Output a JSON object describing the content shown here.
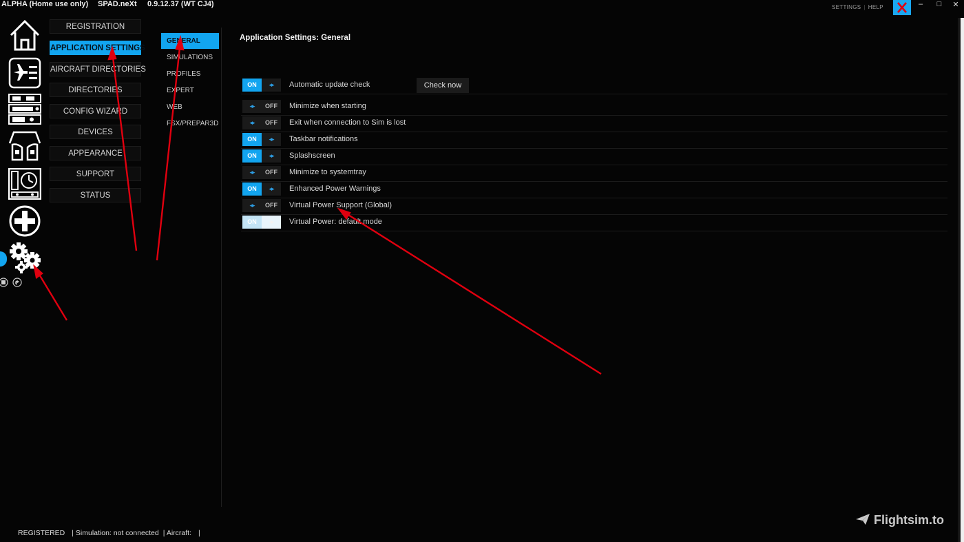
{
  "titlebar": {
    "license": "ALPHA (Home use only)",
    "app_name": "SPAD.neXt",
    "version": "0.9.12.37 (WT CJ4)",
    "settings_link": "SETTINGS",
    "help_link": "HELP",
    "minimize": "–",
    "maximize": "□",
    "close": "✕"
  },
  "nav_icons": [
    "home-icon",
    "aircraft-profile-icon",
    "radio-stack-icon",
    "cockpit-seats-icon",
    "instrument-panel-icon",
    "add-icon",
    "settings-gears-icon"
  ],
  "categories": [
    {
      "label": "REGISTRATION",
      "active": false
    },
    {
      "label": "APPLICATION SETTINGS",
      "active": true
    },
    {
      "label": "AIRCRAFT DIRECTORIES",
      "active": false
    },
    {
      "label": "DIRECTORIES",
      "active": false
    },
    {
      "label": "CONFIG WIZARD",
      "active": false
    },
    {
      "label": "DEVICES",
      "active": false
    },
    {
      "label": "APPEARANCE",
      "active": false
    },
    {
      "label": "SUPPORT",
      "active": false
    },
    {
      "label": "STATUS",
      "active": false
    }
  ],
  "submenu": [
    {
      "label": "GENERAL",
      "active": true
    },
    {
      "label": "SIMULATIONS",
      "active": false
    },
    {
      "label": "PROFILES",
      "active": false
    },
    {
      "label": "EXPERT",
      "active": false
    },
    {
      "label": "WEB",
      "active": false
    },
    {
      "label": "FSX/PREPAR3D",
      "active": false
    }
  ],
  "content": {
    "title": "Application Settings: General",
    "check_now_label": "Check now",
    "settings": [
      {
        "label": "Automatic update check",
        "state": "ON"
      },
      {
        "label": "Minimize when starting",
        "state": "OFF"
      },
      {
        "label": "Exit when connection to Sim is lost",
        "state": "OFF"
      },
      {
        "label": "Taskbar notifications",
        "state": "ON"
      },
      {
        "label": "Splashscreen",
        "state": "ON"
      },
      {
        "label": "Minimize to systemtray",
        "state": "OFF"
      },
      {
        "label": "Enhanced Power Warnings",
        "state": "ON"
      },
      {
        "label": "Virtual Power Support (Global)",
        "state": "OFF"
      },
      {
        "label": "Virtual Power: default mode",
        "state": "ON",
        "disabled": true
      }
    ],
    "toggle_on_text": "ON",
    "toggle_off_text": "OFF",
    "toggle_arrows": "◂▸"
  },
  "statusbar": {
    "registration": "REGISTERED",
    "simulation": "| Simulation: not connected",
    "aircraft": "| Aircraft:",
    "aircraft_tail": "|"
  },
  "watermark": "Flightsim.to",
  "colors": {
    "accent": "#12a5f0",
    "background": "#050505",
    "annotation_arrow": "#e0000f"
  }
}
